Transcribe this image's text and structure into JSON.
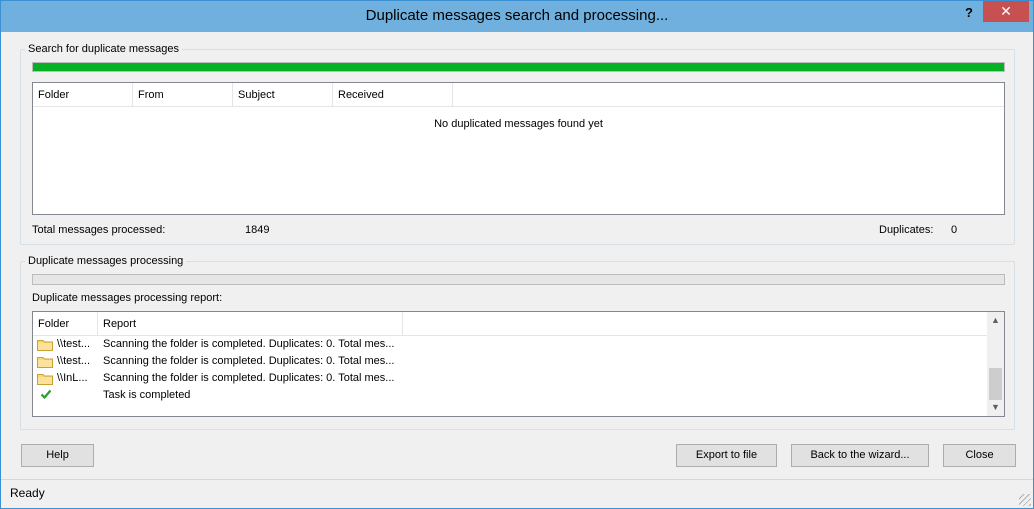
{
  "window": {
    "title": "Duplicate messages search and processing...",
    "help_glyph": "?",
    "close_glyph": "✕"
  },
  "search": {
    "group_label": "Search for duplicate messages",
    "progress_percent": 100,
    "columns": [
      "Folder",
      "From",
      "Subject",
      "Received"
    ],
    "empty_message": "No duplicated messages found yet",
    "total_label": "Total messages processed:",
    "total_value": "1849",
    "duplicates_label": "Duplicates:",
    "duplicates_value": "0"
  },
  "processing": {
    "group_label": "Duplicate messages processing",
    "progress_percent": 0,
    "report_label": "Duplicate messages processing report:",
    "columns": [
      "Folder",
      "Report"
    ],
    "rows": [
      {
        "icon": "folder-icon",
        "folder": "\\\\test...",
        "report": "Scanning the folder is completed. Duplicates: 0. Total mes..."
      },
      {
        "icon": "folder-icon",
        "folder": "\\\\test...",
        "report": "Scanning the folder is completed. Duplicates: 0. Total mes..."
      },
      {
        "icon": "folder-icon",
        "folder": "\\\\InL...",
        "report": "Scanning the folder is completed. Duplicates: 0. Total mes..."
      },
      {
        "icon": "checkmark-icon",
        "folder": "",
        "report": "Task is completed"
      }
    ]
  },
  "buttons": {
    "help": "Help",
    "export": "Export to file",
    "back": "Back to the wizard...",
    "close": "Close"
  },
  "status": {
    "text": "Ready"
  },
  "colors": {
    "titlebar": "#6fb0de",
    "progress_green": "#06b025",
    "close_red": "#c75050"
  }
}
